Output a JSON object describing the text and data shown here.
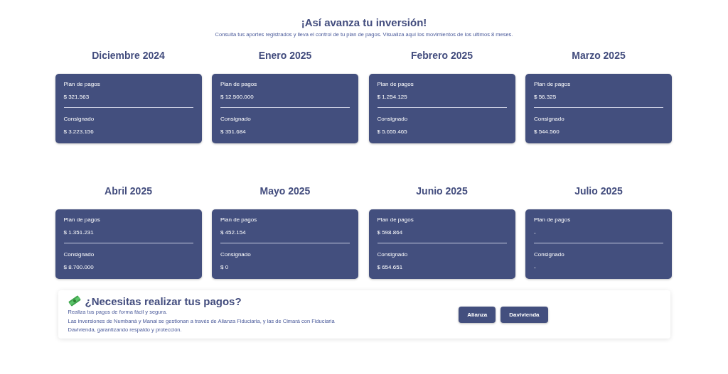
{
  "header": {
    "title": "¡Así avanza tu inversión!",
    "subtitle": "Consulta tus aportes registrados y lleva el control de tu plan de pagos. Visualiza aquí los movimientos de los ultimos 8 meses."
  },
  "months": [
    {
      "month": "Diciembre 2024",
      "plan_label": "Plan de pagos",
      "plan": "$ 321.563",
      "paid_label": "Consignado",
      "paid": "$ 3.223.156"
    },
    {
      "month": "Enero 2025",
      "plan_label": "Plan de pagos",
      "plan": "$ 12.500.000",
      "paid_label": "Consignado",
      "paid": "$ 351.684"
    },
    {
      "month": "Febrero 2025",
      "plan_label": "Plan de pagos",
      "plan": "$ 1.254.125",
      "paid_label": "Consignado",
      "paid": "$ 5.655.465"
    },
    {
      "month": "Marzo 2025",
      "plan_label": "Plan de pagos",
      "plan": "$ 56.325",
      "paid_label": "Consignado",
      "paid": "$ 544.560"
    },
    {
      "month": "Abril 2025",
      "plan_label": "Plan de pagos",
      "plan": "$ 1.351.231",
      "paid_label": "Consignado",
      "paid": "$ 8.700.000"
    },
    {
      "month": "Mayo 2025",
      "plan_label": "Plan de pagos",
      "plan": "$ 452.154",
      "paid_label": "Consignado",
      "paid": "$ 0"
    },
    {
      "month": "Junio 2025",
      "plan_label": "Plan de pagos",
      "plan": "$ 598.864",
      "paid_label": "Consignado",
      "paid": "$ 654.651"
    },
    {
      "month": "Julio 2025",
      "plan_label": "Plan de pagos",
      "plan": "-",
      "paid_label": "Consignado",
      "paid": "-"
    }
  ],
  "payments": {
    "title": "¿Necesitas realizar tus pagos?",
    "lines": [
      "Realiza tus pagos de forma fácil y segura.",
      "Las inversiones de Numbaná y Manai se gestionan a través de Alianza Fiduciaria, y las de Cimará con Fiduciaria Davivienda, garantizando respaldo y protección."
    ],
    "buttons": [
      "Alianza",
      "Davivienda"
    ]
  }
}
